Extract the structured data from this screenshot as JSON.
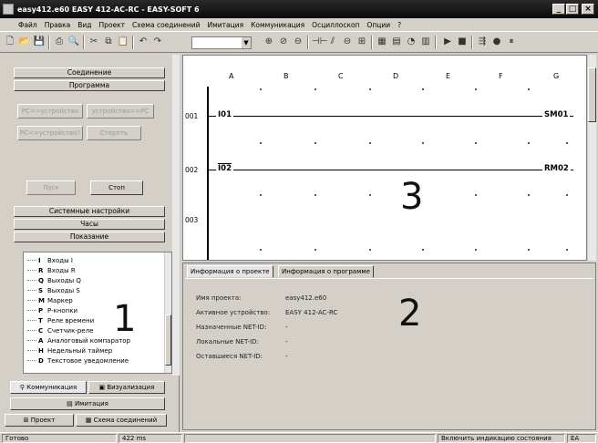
{
  "window": {
    "title": "easy412.e60 EASY 412-AC-RC - EASY-SOFT 6",
    "minimize": "_",
    "maximize": "□",
    "close": "×"
  },
  "menu": [
    "Файл",
    "Правка",
    "Вид",
    "Проект",
    "Схема соединений",
    "Имитация",
    "Коммуникация",
    "Осциллоскоп",
    "Опции",
    "?"
  ],
  "toolbar": {
    "combo_value": ""
  },
  "left_panel": {
    "sections": {
      "connection": "Соединение",
      "program": "Программа",
      "system_settings": "Системные настройки",
      "clock": "Часы",
      "display": "Показание"
    },
    "program_buttons": {
      "pc_to_device": "PC=>устройство",
      "device_to_pc": "устройство=>PC",
      "pc_device": "PC<=устройство?",
      "erase": "Стереть"
    },
    "run_buttons": {
      "start": "Пуск",
      "stop": "Стоп"
    },
    "operands": [
      {
        "code": "I",
        "label": "Входы I"
      },
      {
        "code": "R",
        "label": "Входы R"
      },
      {
        "code": "Q",
        "label": "Выходы Q"
      },
      {
        "code": "S",
        "label": "Выходы S"
      },
      {
        "code": "M",
        "label": "Маркер"
      },
      {
        "code": "P",
        "label": "P-кнопки"
      },
      {
        "code": "T",
        "label": "Реле времени"
      },
      {
        "code": "C",
        "label": "Счетчик-реле"
      },
      {
        "code": "A",
        "label": "Аналоговый компаратор"
      },
      {
        "code": "H",
        "label": "Недельный таймер"
      },
      {
        "code": "D",
        "label": "Текстовое уведомление"
      }
    ],
    "panel_number": "1",
    "tabs": {
      "communication": "Коммуникация",
      "visualization": "Визуализация",
      "simulation": "Имитация",
      "project": "Проект",
      "circuit": "Схема соединений"
    }
  },
  "diagram": {
    "columns": [
      "A",
      "B",
      "C",
      "D",
      "E",
      "F",
      "G"
    ],
    "rows": [
      {
        "num": "001",
        "contact": "I01",
        "coil": "SM01"
      },
      {
        "num": "002",
        "contact": "I02",
        "coil": "RM02"
      },
      {
        "num": "003",
        "contact": "",
        "coil": ""
      }
    ],
    "panel_number": "3"
  },
  "info": {
    "tabs": [
      "Информация о проекте",
      "Информация о программе"
    ],
    "fields": [
      {
        "label": "Имя проекта:",
        "value": "easy412.e60"
      },
      {
        "label": "Активное устройство:",
        "value": "EASY 412-AC-RC"
      },
      {
        "label": "Назначенные NET-ID:",
        "value": "-"
      },
      {
        "label": "Локальные NET-ID:",
        "value": "-"
      },
      {
        "label": "Оставшиеся NET-ID:",
        "value": "-"
      }
    ],
    "panel_number": "2"
  },
  "status": {
    "left": "Готово",
    "time": "422 ms",
    "message": "Включить индикацию состояния",
    "right": "EA"
  }
}
